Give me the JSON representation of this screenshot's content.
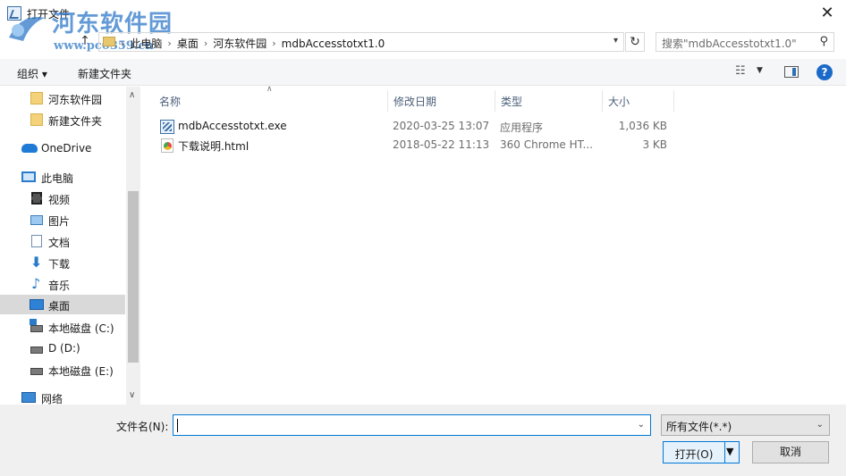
{
  "window": {
    "title": "打开文件",
    "close_glyph": "✕",
    "watermark": "河东软件园",
    "watermark_url": "www.pc0359.cn"
  },
  "address": {
    "crumbs": [
      "此电脑",
      "桌面",
      "河东软件园",
      "mdbAccesstotxt1.0"
    ],
    "search_placeholder": "搜索\"mdbAccesstotxt1.0\""
  },
  "toolbar": {
    "organize": "组织 ▾",
    "new_folder": "新建文件夹"
  },
  "nav": {
    "items": [
      {
        "label": "河东软件园",
        "icon": "folder-icon"
      },
      {
        "label": "新建文件夹",
        "icon": "folder-icon"
      },
      {
        "label": "OneDrive",
        "icon": "onedrive-icon"
      },
      {
        "label": "此电脑",
        "icon": "this-pc-icon"
      },
      {
        "label": "视频",
        "icon": "video-icon"
      },
      {
        "label": "图片",
        "icon": "pictures-icon"
      },
      {
        "label": "文档",
        "icon": "documents-icon"
      },
      {
        "label": "下载",
        "icon": "downloads-icon"
      },
      {
        "label": "音乐",
        "icon": "music-icon"
      },
      {
        "label": "桌面",
        "icon": "desktop-icon"
      },
      {
        "label": "本地磁盘 (C:)",
        "icon": "drive-c-icon"
      },
      {
        "label": "D (D:)",
        "icon": "drive-icon"
      },
      {
        "label": "本地磁盘 (E:)",
        "icon": "drive-icon"
      },
      {
        "label": "网络",
        "icon": "network-icon"
      }
    ],
    "selected_index": 9
  },
  "files": {
    "columns": [
      "名称",
      "修改日期",
      "类型",
      "大小"
    ],
    "rows": [
      {
        "name": "mdbAccesstotxt.exe",
        "date": "2020-03-25 13:07",
        "type": "应用程序",
        "size": "1,036 KB",
        "icon": "exe-icon"
      },
      {
        "name": "下载说明.html",
        "date": "2018-05-22 11:13",
        "type": "360 Chrome HT...",
        "size": "3 KB",
        "icon": "html-icon"
      }
    ]
  },
  "footer": {
    "filename_label": "文件名(N):",
    "filename_value": "",
    "filter_value": "所有文件(*.*)",
    "open_label": "打开(O)",
    "cancel_label": "取消"
  }
}
